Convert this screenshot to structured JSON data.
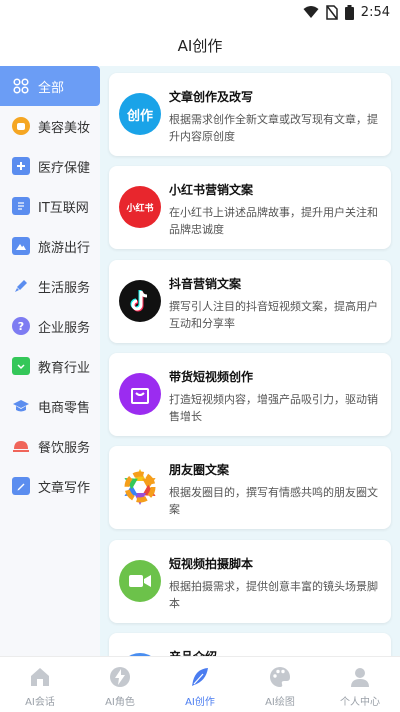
{
  "status": {
    "time": "2:54"
  },
  "header": {
    "title": "AI创作"
  },
  "sidebar": {
    "items": [
      {
        "label": "全部",
        "icon": "grid-icon",
        "color": "#ffffff"
      },
      {
        "label": "美容美妆",
        "icon": "makeup-icon",
        "color": "#f5a623"
      },
      {
        "label": "医疗保健",
        "icon": "hospital-icon",
        "color": "#5b8def"
      },
      {
        "label": "IT互联网",
        "icon": "document-icon",
        "color": "#5b8def"
      },
      {
        "label": "旅游出行",
        "icon": "mountain-icon",
        "color": "#5b8def"
      },
      {
        "label": "生活服务",
        "icon": "brush-icon",
        "color": "#5b8def"
      },
      {
        "label": "企业服务",
        "icon": "question-icon",
        "color": "#7e7cf2"
      },
      {
        "label": "教育行业",
        "icon": "calendar-icon",
        "color": "#34c759"
      },
      {
        "label": "电商零售",
        "icon": "graduation-icon",
        "color": "#5b8def"
      },
      {
        "label": "餐饮服务",
        "icon": "food-cover-icon",
        "color": "#f0655a"
      },
      {
        "label": "文章写作",
        "icon": "pencil-icon",
        "color": "#5b8def"
      }
    ]
  },
  "cards": [
    {
      "title": "文章创作及改写",
      "desc": "根据需求创作全新文章或改写现有文章，提升内容原创度",
      "icon": "create-icon",
      "icon_text": "创作",
      "color": "#1aa3e8"
    },
    {
      "title": "小红书营销文案",
      "desc": "在小红书上讲述品牌故事，提升用户关注和品牌忠诚度",
      "icon": "xiaohongshu-icon",
      "icon_text": "小红书",
      "color": "#e8262d"
    },
    {
      "title": "抖音营销文案",
      "desc": "撰写引人注目的抖音短视频文案，提高用户互动和分享率",
      "icon": "douyin-icon",
      "icon_text": "",
      "color": "#111111"
    },
    {
      "title": "带货短视频创作",
      "desc": "打造短视频内容，增强产品吸引力，驱动销售增长",
      "icon": "shopping-bag-icon",
      "icon_text": "",
      "color": "#9b2cf0"
    },
    {
      "title": "朋友圈文案",
      "desc": "根据发圈目的，撰写有情感共鸣的朋友圈文案",
      "icon": "moments-icon",
      "icon_text": "",
      "color": "#ffffff"
    },
    {
      "title": "短视频拍摄脚本",
      "desc": "根据拍摄需求，提供创意丰富的镜头场景脚本",
      "icon": "video-camera-icon",
      "icon_text": "",
      "color": "#6cc24a"
    },
    {
      "title": "产品介绍",
      "desc": "",
      "icon": "product-icon",
      "icon_text": "",
      "color": "#4a8ef0"
    }
  ],
  "bottom_nav": [
    {
      "label": "AI会话",
      "icon": "home-icon"
    },
    {
      "label": "AI角色",
      "icon": "lightning-icon"
    },
    {
      "label": "AI创作",
      "icon": "feather-icon",
      "active": true
    },
    {
      "label": "AI绘图",
      "icon": "palette-icon"
    },
    {
      "label": "个人中心",
      "icon": "person-icon"
    }
  ]
}
